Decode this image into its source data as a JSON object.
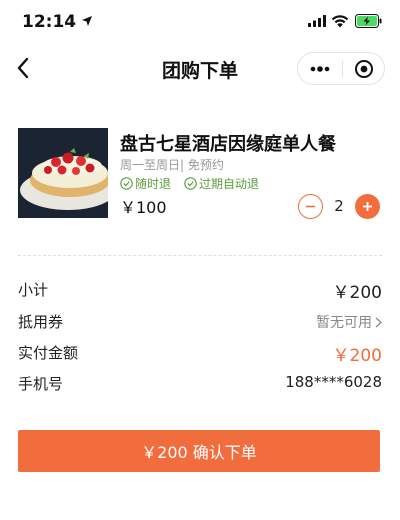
{
  "status_bar": {
    "time": "12:14",
    "icons": [
      "location-arrow-icon",
      "signal-icon",
      "wifi-icon",
      "battery-charging-icon"
    ],
    "battery_color": "#4cd964"
  },
  "nav": {
    "title": "团购下单",
    "back_icon": "chevron-left-icon",
    "more_icon": "more-dots-icon",
    "close_icon": "target-close-icon"
  },
  "product": {
    "name": "盘古七星酒店因缘庭单人餐",
    "schedule": "周一至周日| 免预约",
    "tags": [
      "随时退",
      "过期自动退"
    ],
    "price": "￥100",
    "quantity": "2"
  },
  "summary": {
    "subtotal_label": "小计",
    "subtotal_value": "￥200",
    "coupon_label": "抵用券",
    "coupon_value": "暂无可用",
    "paid_label": "实付金额",
    "paid_value": "￥200",
    "phone_label": "手机号",
    "phone_value": "188****6028"
  },
  "submit": {
    "label": "￥200 确认下单"
  },
  "colors": {
    "accent": "#f26d3d",
    "tag_green": "#5a9e3a",
    "muted": "#999999"
  }
}
